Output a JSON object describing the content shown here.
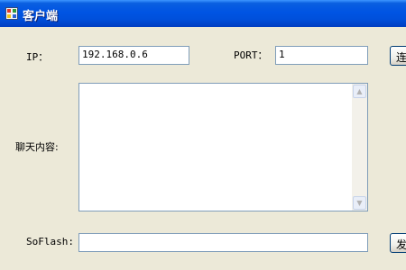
{
  "window": {
    "title": "客户端"
  },
  "form": {
    "ip_label": "IP：",
    "ip_value": "192.168.0.6",
    "port_label": "PORT：",
    "port_value": "1",
    "connect_button": "连",
    "chat_label": "聊天内容:",
    "chat_content": "",
    "soflash_label": "SoFlash:",
    "message_value": "",
    "send_button": "发"
  },
  "icons": {
    "app": "app-window-icon",
    "scroll_up": "scroll-up-arrow-icon",
    "scroll_down": "scroll-down-arrow-icon"
  },
  "colors": {
    "title_bar": "#0054e3",
    "window_bg": "#ece9d8",
    "input_border": "#7f9db9"
  }
}
